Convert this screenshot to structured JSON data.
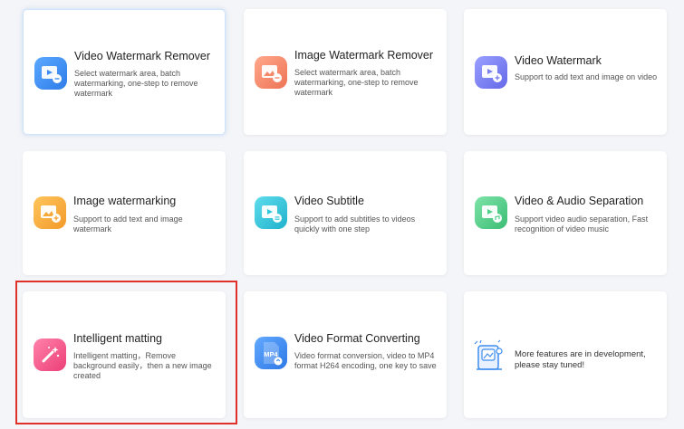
{
  "cards": [
    {
      "title": "Video Watermark Remover",
      "desc": "Select watermark area, batch watermarking, one-step to remove watermark",
      "icon": "video-watermark-remover-icon",
      "color": "#3d8df2"
    },
    {
      "title": "Image Watermark Remover",
      "desc": "Select watermark area, batch watermarking, one-step to remove watermark",
      "icon": "image-watermark-remover-icon",
      "color": "#f58a6a"
    },
    {
      "title": "Video Watermark",
      "desc": "Support to add text and image on video",
      "icon": "video-watermark-icon",
      "color": "#7b7ff0"
    },
    {
      "title": "Image watermarking",
      "desc": "Support to add text and image watermark",
      "icon": "image-watermarking-icon",
      "color": "#f5a93a"
    },
    {
      "title": "Video Subtitle",
      "desc": "Support to add subtitles to videos quickly with one step",
      "icon": "video-subtitle-icon",
      "color": "#2fc7dc"
    },
    {
      "title": "Video & Audio Separation",
      "desc": "Support video audio separation, Fast recognition of video music",
      "icon": "video-audio-separation-icon",
      "color": "#4fd08a"
    },
    {
      "title": "Intelligent matting",
      "desc": "Intelligent matting，Remove background easily，then a new image created",
      "icon": "intelligent-matting-icon",
      "color": "#f2588c"
    },
    {
      "title": "Video Format Converting",
      "desc": "Video format conversion, video to MP4 format H264 encoding, one key to save",
      "icon": "video-format-converting-icon",
      "color": "#3f8ef0",
      "badge": "MP4"
    },
    {
      "title": "",
      "desc": "More features are in development, please stay tuned!",
      "icon": "in-development-illustration-icon",
      "color": "#3f8ef0"
    }
  ]
}
